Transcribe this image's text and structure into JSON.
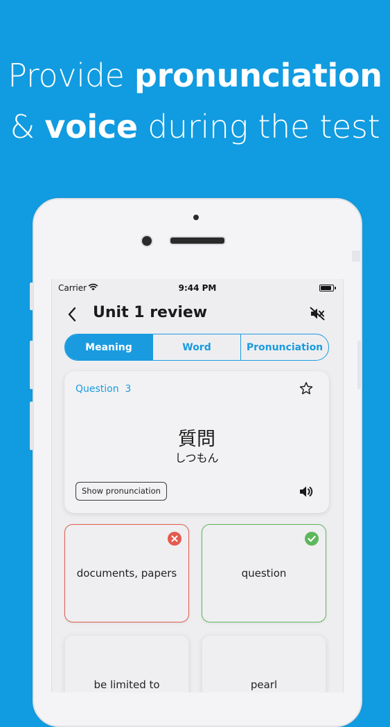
{
  "headline": {
    "line1_light": "Provide",
    "line1_bold": "pronunciation",
    "line2_light_a": "&",
    "line2_bold": "voice",
    "line2_light_b": "during the test"
  },
  "status_bar": {
    "carrier": "Carrier",
    "time": "9:44 PM"
  },
  "nav": {
    "title": "Unit 1 review"
  },
  "tabs": [
    {
      "label": "Meaning",
      "active": true
    },
    {
      "label": "Word",
      "active": false
    },
    {
      "label": "Pronunciation",
      "active": false
    }
  ],
  "question": {
    "label": "Question",
    "number": "3",
    "word": "質問",
    "reading": "しつもん",
    "show_pronunciation_label": "Show pronunciation"
  },
  "answers": [
    {
      "text": "documents, papers",
      "state": "wrong"
    },
    {
      "text": "question",
      "state": "correct"
    },
    {
      "text": "be limited to",
      "state": "none"
    },
    {
      "text": "pearl",
      "state": "none"
    }
  ],
  "colors": {
    "background": "#119be0",
    "accent": "#1a9be0",
    "wrong": "#e25b4e",
    "correct": "#5cb85c"
  },
  "icons": {
    "back": "chevron-left-icon",
    "mute": "speaker-muted-icon",
    "favorite": "star-outline-icon",
    "speaker": "speaker-icon",
    "wrong_mark": "x-circle-icon",
    "correct_mark": "check-circle-icon"
  }
}
